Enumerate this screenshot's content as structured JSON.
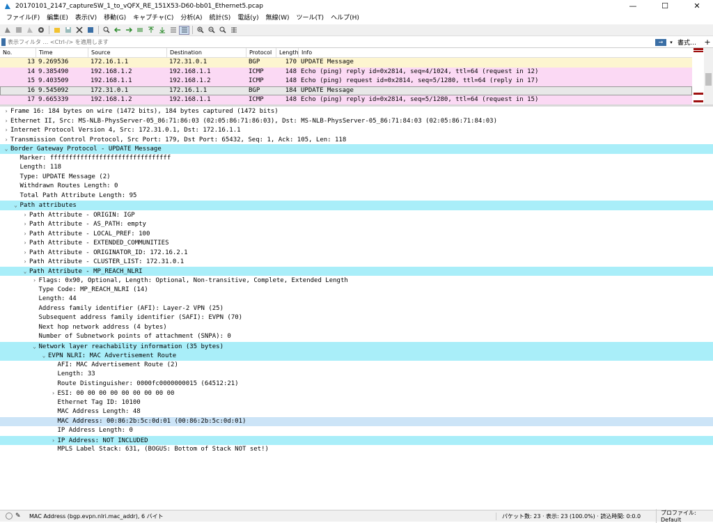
{
  "window": {
    "title": "20170101_2147_captureSW_1_to_vQFX_RE_151X53-D60-bb01_Ethernet5.pcap",
    "minimize": "—",
    "maximize": "☐",
    "close": "✕"
  },
  "menu": [
    "ファイル(F)",
    "編集(E)",
    "表示(V)",
    "移動(G)",
    "キャプチャ(C)",
    "分析(A)",
    "統計(S)",
    "電話(y)",
    "無線(W)",
    "ツール(T)",
    "ヘルプ(H)"
  ],
  "filter": {
    "placeholder": "表示フィルタ … <Ctrl-/> を適用します",
    "apply": "→",
    "dropdown": "▾",
    "expression": "書式…",
    "add": "+"
  },
  "packet_list": {
    "columns": [
      "No.",
      "Time",
      "Source",
      "Destination",
      "Protocol",
      "Length",
      "Info"
    ],
    "rows": [
      {
        "no": "13",
        "time": "9.269536",
        "src": "172.16.1.1",
        "dst": "172.31.0.1",
        "proto": "BGP",
        "len": "170",
        "info": "UPDATE Message"
      },
      {
        "no": "14",
        "time": "9.385490",
        "src": "192.168.1.2",
        "dst": "192.168.1.1",
        "proto": "ICMP",
        "len": "148",
        "info": "Echo (ping) reply    id=0x2814, seq=4/1024, ttl=64 (request in 12)"
      },
      {
        "no": "15",
        "time": "9.403509",
        "src": "192.168.1.1",
        "dst": "192.168.1.2",
        "proto": "ICMP",
        "len": "148",
        "info": "Echo (ping) request  id=0x2814, seq=5/1280, ttl=64 (reply in 17)"
      },
      {
        "no": "16",
        "time": "9.545092",
        "src": "172.31.0.1",
        "dst": "172.16.1.1",
        "proto": "BGP",
        "len": "184",
        "info": "UPDATE Message"
      },
      {
        "no": "17",
        "time": "9.665339",
        "src": "192.168.1.2",
        "dst": "192.168.1.1",
        "proto": "ICMP",
        "len": "148",
        "info": "Echo (ping) reply    id=0x2814, seq=5/1280, ttl=64 (request in 15)"
      }
    ]
  },
  "details": [
    {
      "text": "Frame 16: 184 bytes on wire (1472 bits), 184 bytes captured (1472 bits)",
      "arrow": "›"
    },
    {
      "text": "Ethernet II, Src: MS-NLB-PhysServer-05_86:71:86:03 (02:05:86:71:86:03), Dst: MS-NLB-PhysServer-05_86:71:84:03 (02:05:86:71:84:03)",
      "arrow": "›"
    },
    {
      "text": "Internet Protocol Version 4, Src: 172.31.0.1, Dst: 172.16.1.1",
      "arrow": "›"
    },
    {
      "text": "Transmission Control Protocol, Src Port: 179, Dst Port: 65432, Seq: 1, Ack: 105, Len: 118",
      "arrow": "›"
    },
    {
      "text": "Border Gateway Protocol - UPDATE Message",
      "arrow": "⌄"
    },
    {
      "text": "Marker: ffffffffffffffffffffffffffffffff",
      "arrow": ""
    },
    {
      "text": "Length: 118",
      "arrow": ""
    },
    {
      "text": "Type: UPDATE Message (2)",
      "arrow": ""
    },
    {
      "text": "Withdrawn Routes Length: 0",
      "arrow": ""
    },
    {
      "text": "Total Path Attribute Length: 95",
      "arrow": ""
    },
    {
      "text": "Path attributes",
      "arrow": "⌄"
    },
    {
      "text": "Path Attribute - ORIGIN: IGP",
      "arrow": "›"
    },
    {
      "text": "Path Attribute - AS_PATH: empty",
      "arrow": "›"
    },
    {
      "text": "Path Attribute - LOCAL_PREF: 100",
      "arrow": "›"
    },
    {
      "text": "Path Attribute - EXTENDED_COMMUNITIES",
      "arrow": "›"
    },
    {
      "text": "Path Attribute - ORIGINATOR_ID: 172.16.2.1",
      "arrow": "›"
    },
    {
      "text": "Path Attribute - CLUSTER_LIST: 172.31.0.1",
      "arrow": "›"
    },
    {
      "text": "Path Attribute - MP_REACH_NLRI",
      "arrow": "⌄"
    },
    {
      "text": "Flags: 0x90, Optional, Length: Optional, Non-transitive, Complete, Extended Length",
      "arrow": "›"
    },
    {
      "text": "Type Code: MP_REACH_NLRI (14)",
      "arrow": ""
    },
    {
      "text": "Length: 44",
      "arrow": ""
    },
    {
      "text": "Address family identifier (AFI): Layer-2 VPN (25)",
      "arrow": ""
    },
    {
      "text": "Subsequent address family identifier (SAFI): EVPN (70)",
      "arrow": ""
    },
    {
      "text": "Next hop network address (4 bytes)",
      "arrow": ""
    },
    {
      "text": "Number of Subnetwork points of attachment (SNPA): 0",
      "arrow": ""
    },
    {
      "text": "Network layer reachability information (35 bytes)",
      "arrow": "⌄"
    },
    {
      "text": "EVPN NLRI: MAC Advertisement Route",
      "arrow": "⌄"
    },
    {
      "text": "AFI: MAC Advertisement Route (2)",
      "arrow": ""
    },
    {
      "text": "Length: 33",
      "arrow": ""
    },
    {
      "text": "Route Distinguisher: 0000fc0000000015 (64512:21)",
      "arrow": ""
    },
    {
      "text": "ESI: 00 00 00 00 00 00 00 00 00",
      "arrow": "›"
    },
    {
      "text": "Ethernet Tag ID: 10100",
      "arrow": ""
    },
    {
      "text": "MAC Address Length: 48",
      "arrow": ""
    },
    {
      "text": "MAC Address: 00:86:2b:5c:0d:01 (00:86:2b:5c:0d:01)",
      "arrow": ""
    },
    {
      "text": "IP Address Length: 0",
      "arrow": ""
    },
    {
      "text": "IP Address: NOT INCLUDED",
      "arrow": "›"
    },
    {
      "text": "MPLS Label Stack: 631, (BOGUS: Bottom of Stack NOT set!)",
      "arrow": ""
    }
  ],
  "status": {
    "field": "MAC Address (bgp.evpn.nlri.mac_addr), 6 バイト",
    "packets": "パケット数: 23 · 表示: 23 (100.0%) · 読込時間: 0:0.0",
    "profile": "プロファイル: Default"
  },
  "colors": {
    "bgp_row": "#fdf5d0",
    "icmp_row": "#fbd9f4",
    "highlight": "#a9eef9",
    "selected_field": "#cce4f7"
  }
}
